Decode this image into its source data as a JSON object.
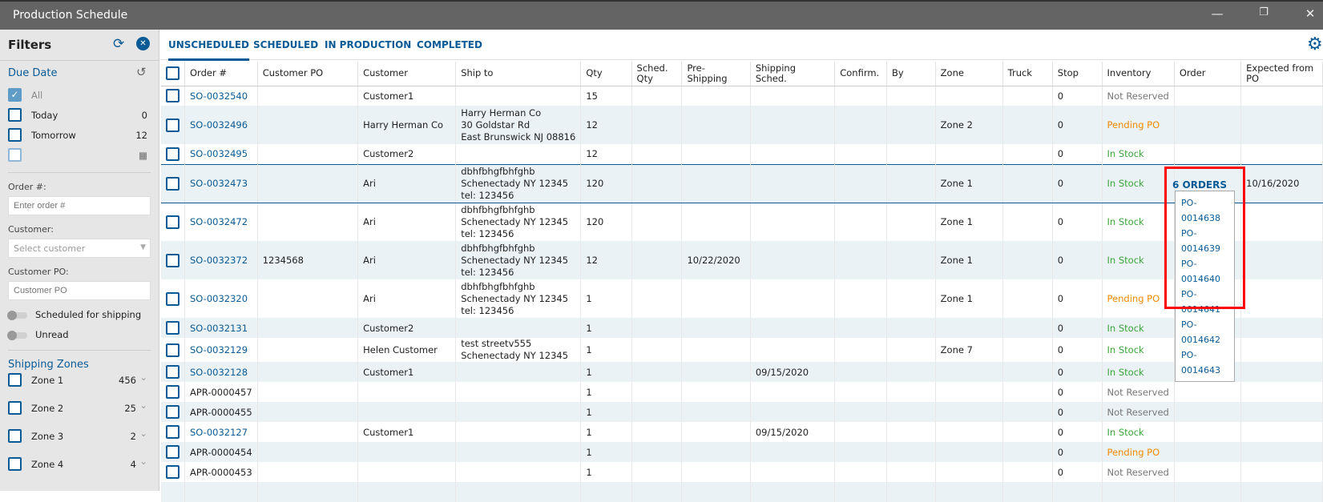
{
  "window": {
    "title": "Production Schedule",
    "minimize": "—",
    "restore": "❐",
    "close": "✕"
  },
  "filters": {
    "title": "Filters",
    "due_date": "Due Date",
    "due_items": [
      {
        "label": "All",
        "count": ""
      },
      {
        "label": "Today",
        "count": "0"
      },
      {
        "label": "Tomorrow",
        "count": "12"
      }
    ],
    "order_label": "Order #:",
    "order_placeholder": "Enter order #",
    "customer_label": "Customer:",
    "customer_placeholder": "Select customer",
    "po_label": "Customer PO:",
    "po_placeholder": "Customer PO",
    "toggle_scheduled": "Scheduled for shipping",
    "toggle_unread": "Unread",
    "zones_title": "Shipping Zones",
    "zones": [
      {
        "label": "Zone 1",
        "count": "456"
      },
      {
        "label": "Zone 2",
        "count": "25"
      },
      {
        "label": "Zone 3",
        "count": "2"
      },
      {
        "label": "Zone 4",
        "count": "4"
      }
    ]
  },
  "tabs": [
    "UNSCHEDULED",
    "SCHEDULED",
    "IN PRODUCTION",
    "COMPLETED"
  ],
  "columns": [
    "Order #",
    "Customer PO",
    "Customer",
    "Ship to",
    "Qty",
    "Sched. Qty",
    "Pre-Shipping",
    "Shipping Sched.",
    "Confirm.",
    "By",
    "Zone",
    "Truck",
    "Stop",
    "Inventory",
    "Order",
    "Expected from PO"
  ],
  "rows": [
    [
      "SO-0032540",
      "",
      "Customer1",
      "",
      "15",
      "",
      "",
      "",
      "",
      "",
      "",
      "",
      "0",
      "Not Reserved",
      "",
      ""
    ],
    [
      "SO-0032496",
      "",
      "Harry Herman Co",
      "Harry Herman Co\n30 Goldstar Rd\nEast Brunswick NJ 08816",
      "12",
      "",
      "",
      "",
      "",
      "",
      "Zone 2",
      "",
      "0",
      "Pending PO",
      "",
      ""
    ],
    [
      "SO-0032495",
      "",
      "Customer2",
      "",
      "12",
      "",
      "",
      "",
      "",
      "",
      "",
      "",
      "0",
      "In Stock",
      "",
      ""
    ],
    [
      "SO-0032473",
      "",
      "Ari",
      "dbhfbhgfbhfghb\nSchenectady NY 12345\ntel: 123456",
      "120",
      "",
      "",
      "",
      "",
      "",
      "Zone 1",
      "",
      "0",
      "In Stock",
      "",
      "10/16/2020"
    ],
    [
      "SO-0032472",
      "",
      "Ari",
      "dbhfbhgfbhfghb\nSchenectady NY 12345\ntel: 123456",
      "120",
      "",
      "",
      "",
      "",
      "",
      "Zone 1",
      "",
      "0",
      "In Stock",
      "",
      ""
    ],
    [
      "SO-0032372",
      "1234568",
      "Ari",
      "dbhfbhgfbhfghb\nSchenectady NY 12345\ntel: 123456",
      "12",
      "",
      "10/22/2020",
      "",
      "",
      "",
      "Zone 1",
      "",
      "0",
      "In Stock",
      "",
      ""
    ],
    [
      "SO-0032320",
      "",
      "Ari",
      "dbhfbhgfbhfghb\nSchenectady NY 12345\ntel: 123456",
      "1",
      "",
      "",
      "",
      "",
      "",
      "Zone 1",
      "",
      "0",
      "Pending PO",
      "",
      ""
    ],
    [
      "SO-0032131",
      "",
      "Customer2",
      "",
      "1",
      "",
      "",
      "",
      "",
      "",
      "",
      "",
      "0",
      "In Stock",
      "",
      ""
    ],
    [
      "SO-0032129",
      "",
      "Helen Customer",
      "test streetv555\nSchenectady NY 12345",
      "1",
      "",
      "",
      "",
      "",
      "",
      "Zone 7",
      "",
      "0",
      "In Stock",
      "",
      ""
    ],
    [
      "SO-0032128",
      "",
      "Customer1",
      "",
      "1",
      "",
      "",
      "09/15/2020",
      "",
      "",
      "",
      "",
      "0",
      "In Stock",
      "",
      ""
    ],
    [
      "APR-0000457",
      "",
      "",
      "",
      "1",
      "",
      "",
      "",
      "",
      "",
      "",
      "",
      "0",
      "Not Reserved",
      "",
      ""
    ],
    [
      "APR-0000455",
      "",
      "",
      "",
      "1",
      "",
      "",
      "",
      "",
      "",
      "",
      "",
      "0",
      "Not Reserved",
      "",
      ""
    ],
    [
      "SO-0032127",
      "",
      "Customer1",
      "",
      "1",
      "",
      "",
      "09/15/2020",
      "",
      "",
      "",
      "",
      "0",
      "In Stock",
      "",
      ""
    ],
    [
      "APR-0000454",
      "",
      "",
      "",
      "1",
      "",
      "",
      "",
      "",
      "",
      "",
      "",
      "0",
      "Pending PO",
      "",
      ""
    ],
    [
      "APR-0000453",
      "",
      "",
      "",
      "1",
      "",
      "",
      "",
      "",
      "",
      "",
      "",
      "0",
      "Not Reserved",
      "",
      ""
    ],
    [
      "",
      "",
      "",
      "",
      "",
      "",
      "",
      "",
      "",
      "",
      "",
      "",
      "",
      "",
      "",
      ""
    ]
  ],
  "order_popup": {
    "label": "6 ORDERS",
    "items": [
      "PO-0014638",
      "PO-0014639",
      "PO-0014640",
      "PO-0014641",
      "PO-0014642",
      "PO-0014643"
    ]
  }
}
